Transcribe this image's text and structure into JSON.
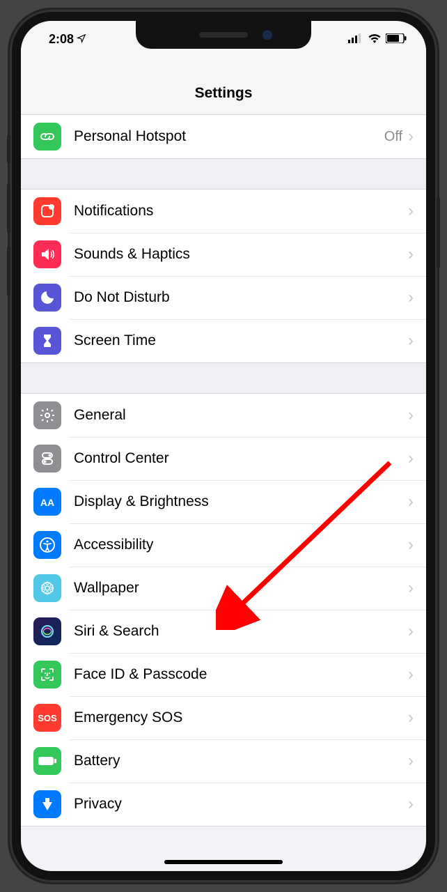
{
  "status": {
    "time": "2:08",
    "location_icon": "location-arrow",
    "signal": "signal-bars",
    "wifi": "wifi",
    "battery": "battery"
  },
  "header": {
    "title": "Settings"
  },
  "groups": [
    {
      "rows": [
        {
          "icon": "link-icon",
          "icon_color": "#34c759",
          "label": "Personal Hotspot",
          "detail": "Off"
        }
      ]
    },
    {
      "rows": [
        {
          "icon": "notifications-icon",
          "icon_color": "#ff3b30",
          "label": "Notifications"
        },
        {
          "icon": "sounds-icon",
          "icon_color": "#ff2d55",
          "label": "Sounds & Haptics"
        },
        {
          "icon": "dnd-icon",
          "icon_color": "#5856d6",
          "label": "Do Not Disturb"
        },
        {
          "icon": "screen-time-icon",
          "icon_color": "#5856d6",
          "label": "Screen Time"
        }
      ]
    },
    {
      "rows": [
        {
          "icon": "general-icon",
          "icon_color": "#8e8e93",
          "label": "General"
        },
        {
          "icon": "control-center-icon",
          "icon_color": "#8e8e93",
          "label": "Control Center"
        },
        {
          "icon": "display-icon",
          "icon_color": "#007aff",
          "label": "Display & Brightness"
        },
        {
          "icon": "accessibility-icon",
          "icon_color": "#007aff",
          "label": "Accessibility"
        },
        {
          "icon": "wallpaper-icon",
          "icon_color": "#54c8e8",
          "label": "Wallpaper"
        },
        {
          "icon": "siri-icon",
          "icon_color": "#222",
          "label": "Siri & Search"
        },
        {
          "icon": "faceid-icon",
          "icon_color": "#34c759",
          "label": "Face ID & Passcode"
        },
        {
          "icon": "sos-icon",
          "icon_color": "#ff3b30",
          "label": "Emergency SOS"
        },
        {
          "icon": "battery-icon",
          "icon_color": "#34c759",
          "label": "Battery"
        },
        {
          "icon": "privacy-icon",
          "icon_color": "#007aff",
          "label": "Privacy"
        }
      ]
    }
  ],
  "annotation": {
    "target": "Wallpaper",
    "color": "#ff0000"
  }
}
